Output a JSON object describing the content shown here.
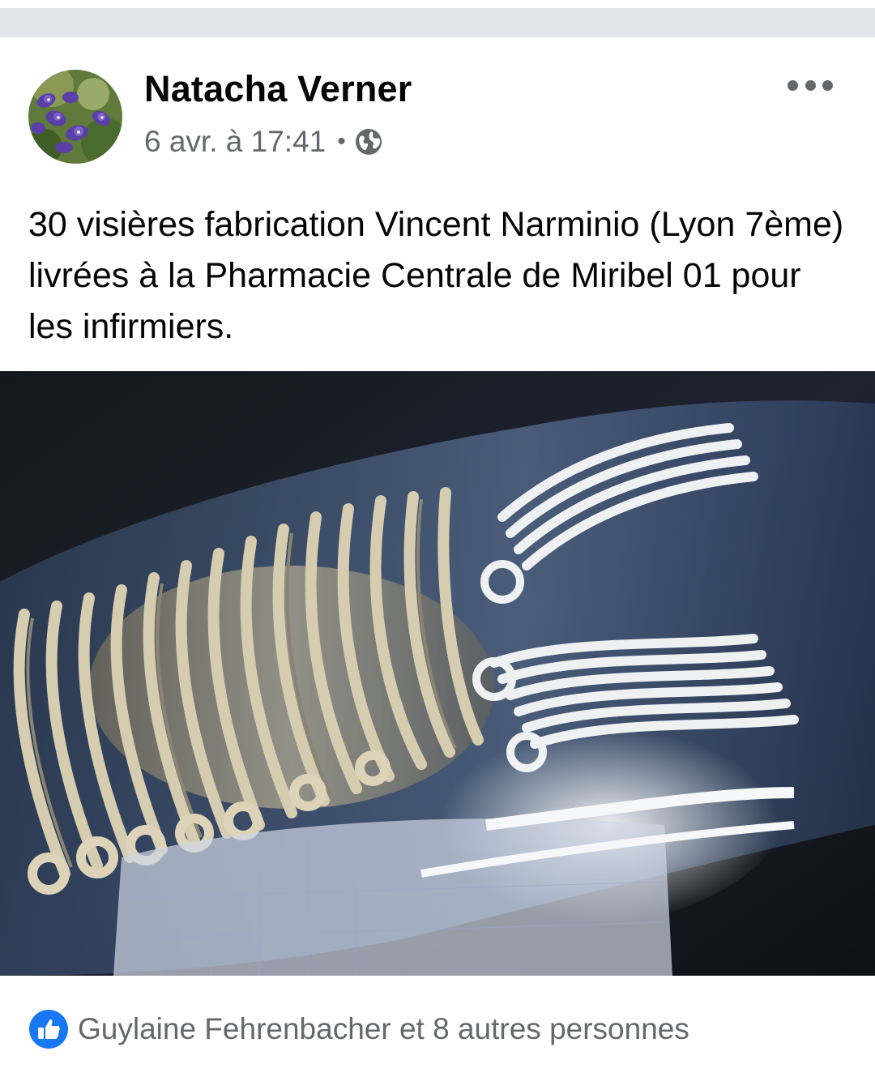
{
  "post": {
    "author": "Natacha Verner",
    "timestamp": "6 avr. à 17:41",
    "separator": "•",
    "audience_icon": "globe-icon",
    "more_icon": "more-options-icon",
    "text": "30 visières fabrication Vincent Narminio (Lyon 7ème) livrées à la Pharmacie Centrale de Miribel 01 pour les infirmiers.",
    "photo_subject": "face-shield-visors-stack"
  },
  "reactions": {
    "icon": "like-icon",
    "text": "Guylaine Fehrenbacher et 8 autres personnes"
  },
  "colors": {
    "text_primary": "#050505",
    "text_secondary": "#65676b",
    "like_blue": "#1877f2",
    "divider": "#e4e6eb"
  }
}
